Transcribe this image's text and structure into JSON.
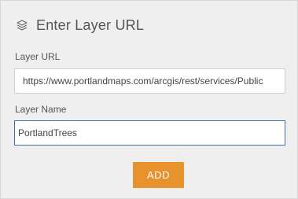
{
  "header": {
    "icon": "layers-icon",
    "title": "Enter Layer URL"
  },
  "form": {
    "url_label": "Layer URL",
    "url_value": "https://www.portlandmaps.com/arcgis/rest/services/Public",
    "name_label": "Layer Name",
    "name_value": "PortlandTrees"
  },
  "actions": {
    "add_label": "ADD"
  },
  "colors": {
    "panel_background": "#efefef",
    "accent": "#e8922e",
    "focus_border": "#3c6ea8"
  }
}
